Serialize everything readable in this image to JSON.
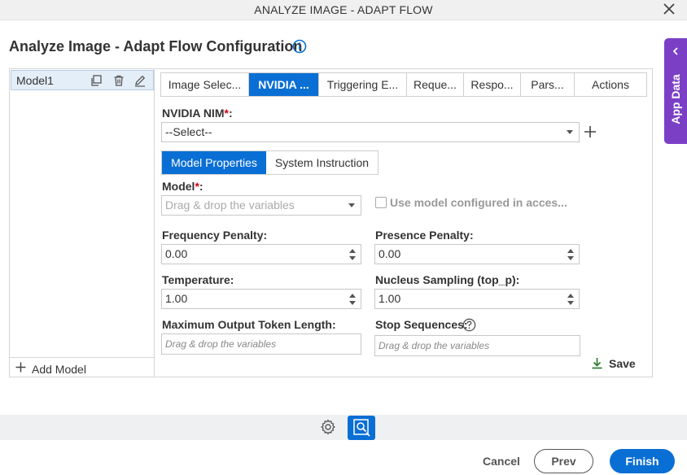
{
  "window": {
    "title": "ANALYZE IMAGE - ADAPT FLOW"
  },
  "page": {
    "title": "Analyze Image - Adapt Flow Configuration"
  },
  "side_tab": {
    "label": "App Data"
  },
  "models": {
    "items": [
      {
        "name": "Model1"
      }
    ],
    "add_label": "Add Model"
  },
  "tabs": [
    {
      "label": "Image Selec..."
    },
    {
      "label": "NVIDIA ...",
      "active": true
    },
    {
      "label": "Triggering E..."
    },
    {
      "label": "Reque..."
    },
    {
      "label": "Respo..."
    },
    {
      "label": "Pars..."
    },
    {
      "label": "Actions"
    }
  ],
  "nim": {
    "label": "NVIDIA NIM",
    "required": "*",
    "colon": ":",
    "value": "--Select--"
  },
  "subtabs": [
    {
      "label": "Model Properties",
      "active": true
    },
    {
      "label": "System Instruction"
    }
  ],
  "form": {
    "model": {
      "label": "Model",
      "required": "*",
      "colon": ":",
      "placeholder": "Drag & drop the variables"
    },
    "use_model_label": "Use model configured in acces...",
    "frequency_penalty": {
      "label": "Frequency Penalty:",
      "value": "0.00"
    },
    "presence_penalty": {
      "label": "Presence Penalty:",
      "value": "0.00"
    },
    "temperature": {
      "label": "Temperature:",
      "value": "1.00"
    },
    "nucleus_sampling": {
      "label": "Nucleus Sampling (top_p):",
      "value": "1.00"
    },
    "max_tokens": {
      "label": "Maximum Output Token Length:",
      "placeholder": "Drag & drop the variables"
    },
    "stop_sequences": {
      "label": "Stop Sequences:",
      "placeholder": "Drag & drop the variables"
    },
    "save_label": "Save"
  },
  "footer": {
    "cancel": "Cancel",
    "prev": "Prev",
    "finish": "Finish"
  },
  "colors": {
    "accent": "#0a6fd4",
    "side_tab": "#7b3fc6",
    "save_icon": "#2e7d32"
  }
}
